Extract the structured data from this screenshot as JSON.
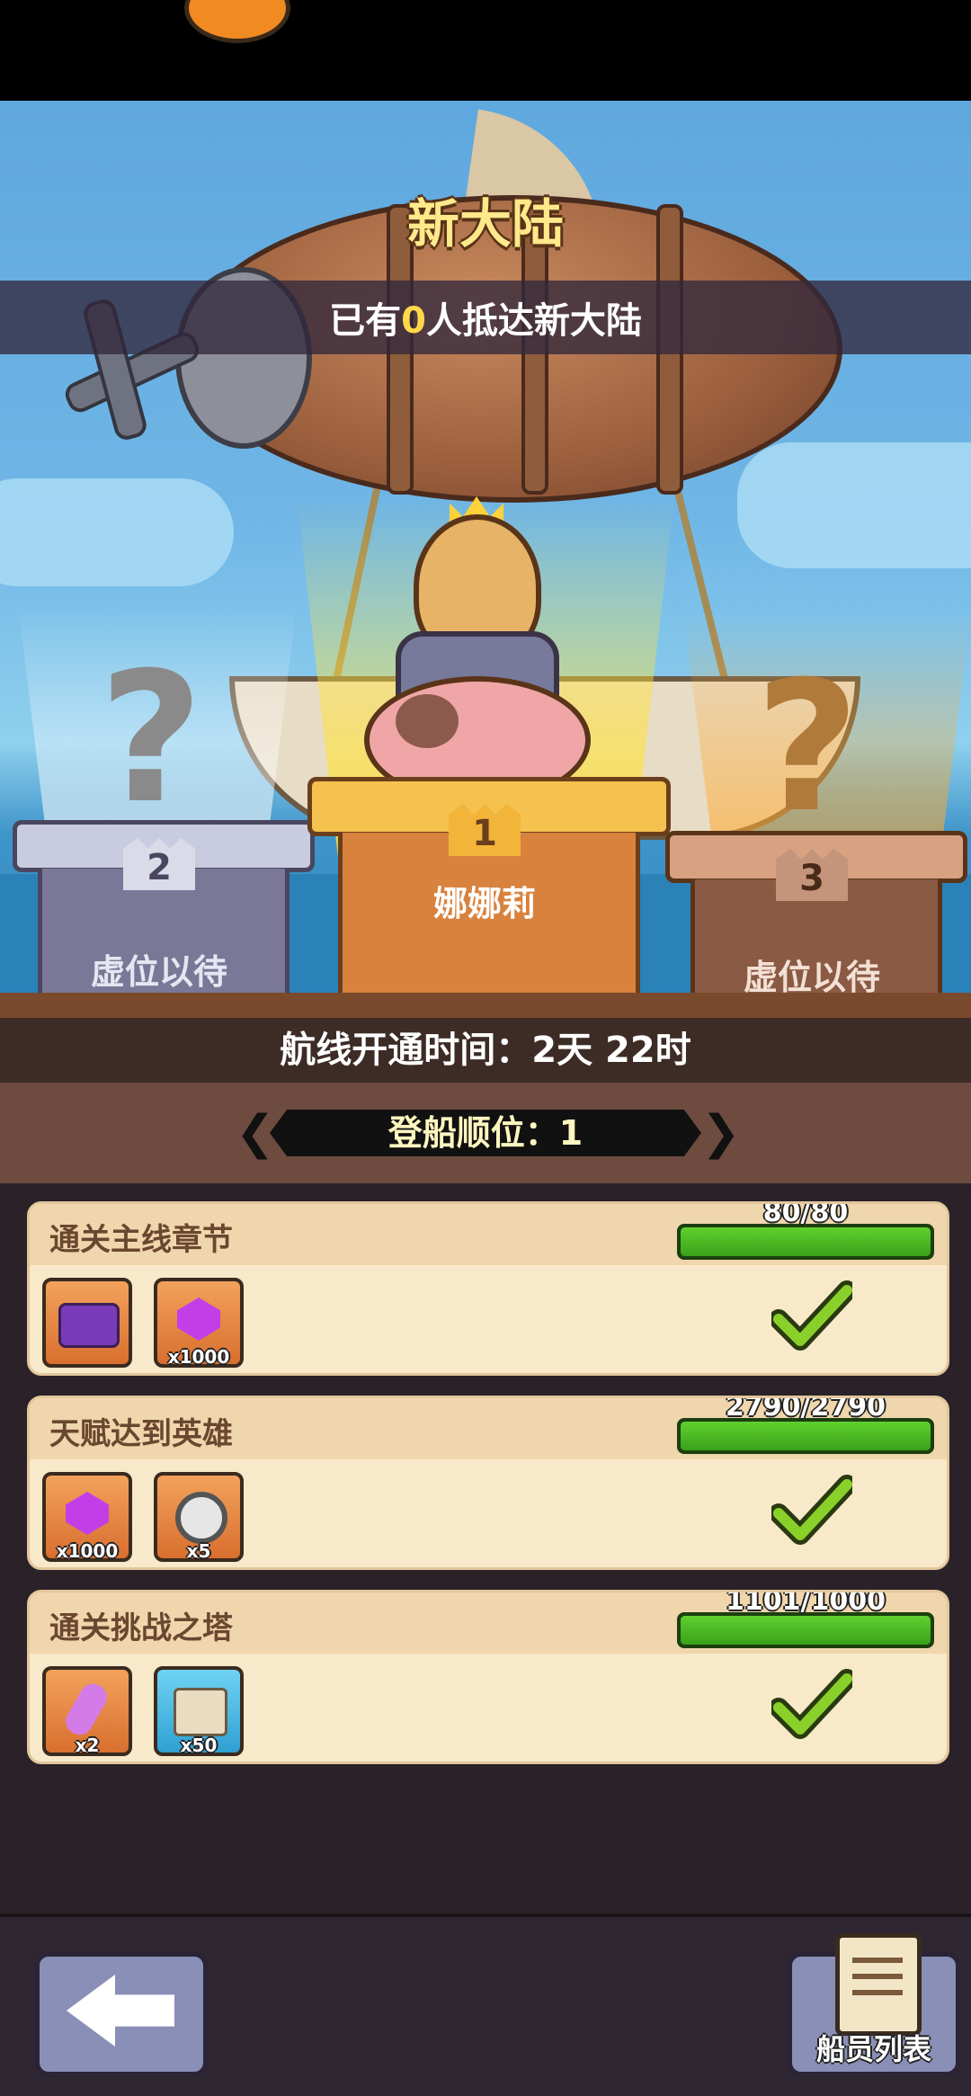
{
  "header": {
    "title": "新大陆",
    "arrival_prefix": "已有",
    "arrival_count": "0",
    "arrival_suffix": "人抵达新大陆"
  },
  "podiums": [
    {
      "rank": "2",
      "name": "虚位以待"
    },
    {
      "rank": "1",
      "name": "娜娜莉"
    },
    {
      "rank": "3",
      "name": "虚位以待"
    }
  ],
  "question_mark": "?",
  "route": {
    "text": "航线开通时间：2天 22时"
  },
  "order": {
    "text": "登船顺位：1",
    "prev_icon": "chevron-left-icon",
    "next_icon": "chevron-right-icon"
  },
  "tasks": [
    {
      "title": "通关主线章节",
      "progress_text": "80/80",
      "progress": 1.0,
      "rewards": [
        {
          "icon": "treasure-chest-icon",
          "count": ""
        },
        {
          "icon": "purple-gem-icon",
          "count": "x1000"
        }
      ],
      "status_icon": "checkmark-icon"
    },
    {
      "title": "天赋达到英雄",
      "progress_text": "2790/2790",
      "progress": 1.0,
      "rewards": [
        {
          "icon": "purple-gem-icon",
          "count": "x1000"
        },
        {
          "icon": "silver-coin-icon",
          "count": "x5"
        }
      ],
      "status_icon": "checkmark-icon"
    },
    {
      "title": "通关挑战之塔",
      "progress_text": "1101/1000",
      "progress": 1.0,
      "rewards": [
        {
          "icon": "purple-key-icon",
          "count": "x2"
        },
        {
          "icon": "scroll-icon",
          "count": "x50"
        }
      ],
      "status_icon": "checkmark-icon"
    }
  ],
  "bottom": {
    "back_icon": "back-arrow-icon",
    "crew_label": "船员列表",
    "crew_icon": "document-icon"
  },
  "colors": {
    "title": "#ffe98a",
    "highlight": "#ffd84a",
    "progress_green": "#5fd12e",
    "check_green": "#8ad02a"
  }
}
